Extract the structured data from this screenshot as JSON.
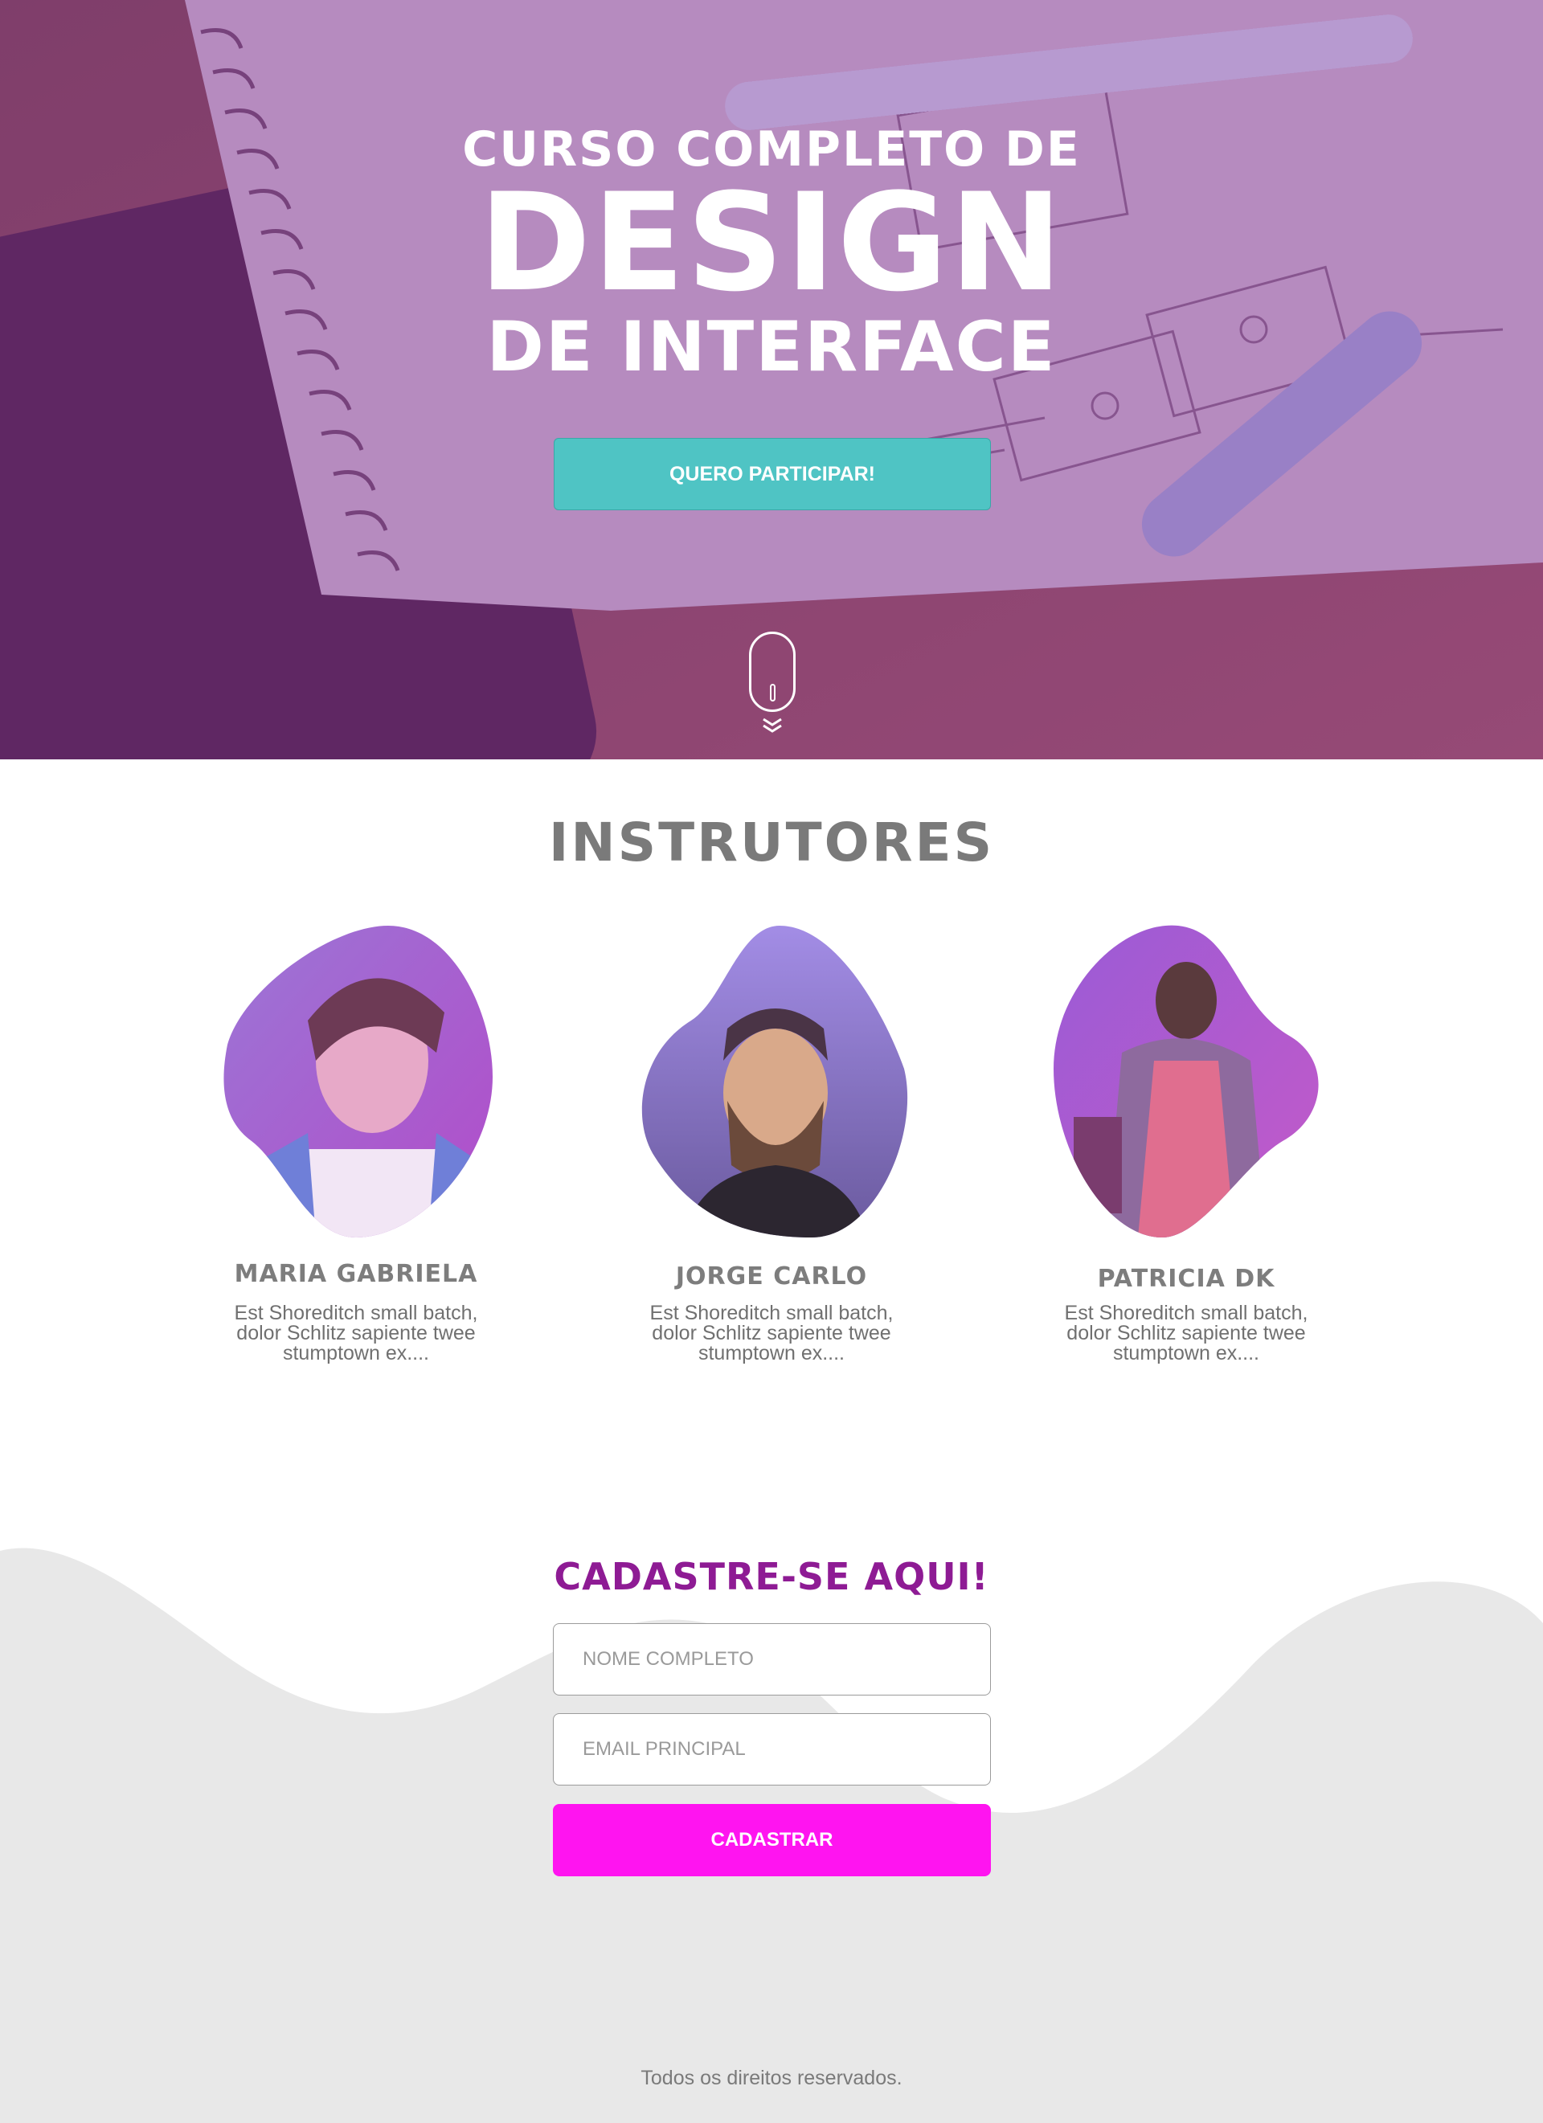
{
  "hero": {
    "line1": "CURSO COMPLETO DE",
    "line2": "DESIGN",
    "line3": "DE INTERFACE",
    "cta_label": "QUERO PARTICIPAR!"
  },
  "instructors": {
    "title": "INSTRUTORES",
    "items": [
      {
        "name": "MARIA GABRIELA",
        "bio": "Est Shoreditch small batch, dolor Schlitz sapiente twee stumptown ex...."
      },
      {
        "name": "JORGE CARLO",
        "bio": "Est Shoreditch small batch, dolor Schlitz sapiente twee stumptown ex...."
      },
      {
        "name": "PATRICIA DK",
        "bio": "Est Shoreditch small batch, dolor Schlitz sapiente twee stumptown ex...."
      }
    ]
  },
  "signup": {
    "title": "CADASTRE-SE AQUI!",
    "name_placeholder": "NOME COMPLETO",
    "email_placeholder": "EMAIL PRINCIPAL",
    "submit_label": "CADASTRAR"
  },
  "footer": {
    "text": "Todos os direitos reservados."
  },
  "colors": {
    "cta": "#4fc4c4",
    "submit": "#ff14f0",
    "signup_title": "#8e1b94",
    "hero_overlay": "#8c3c96",
    "wave": "#e8e8e8"
  },
  "icons": {
    "scroll": "mouse-scroll-icon",
    "chevrons": "double-chevron-down-icon"
  }
}
